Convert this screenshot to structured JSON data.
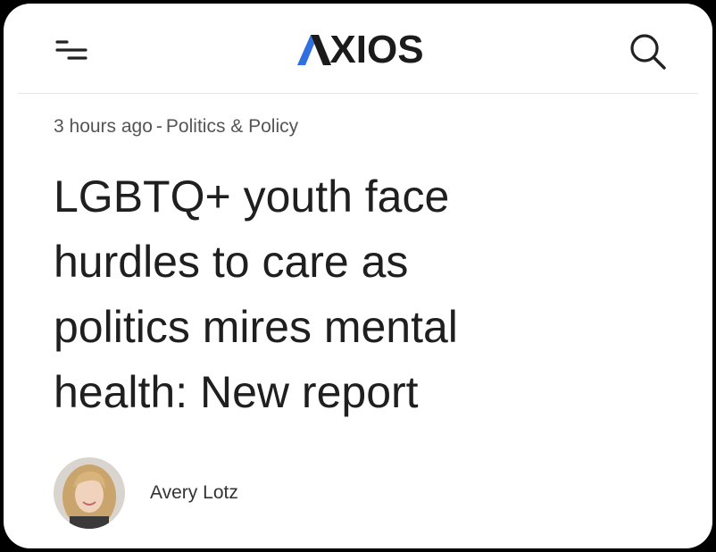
{
  "header": {
    "menu_icon": "menu-icon",
    "logo_text": "XIOS",
    "logo_full": "AXIOS",
    "logo_accent_color": "#2f6fe0",
    "search_icon": "search-icon"
  },
  "article": {
    "timestamp": "3 hours ago",
    "separator": "-",
    "section": "Politics & Policy",
    "headline_lines": [
      "LGBTQ+ youth face",
      "hurdles to care as",
      "politics mires mental",
      "health: New report"
    ],
    "author": {
      "name": "Avery Lotz",
      "avatar": "author-avatar"
    }
  }
}
